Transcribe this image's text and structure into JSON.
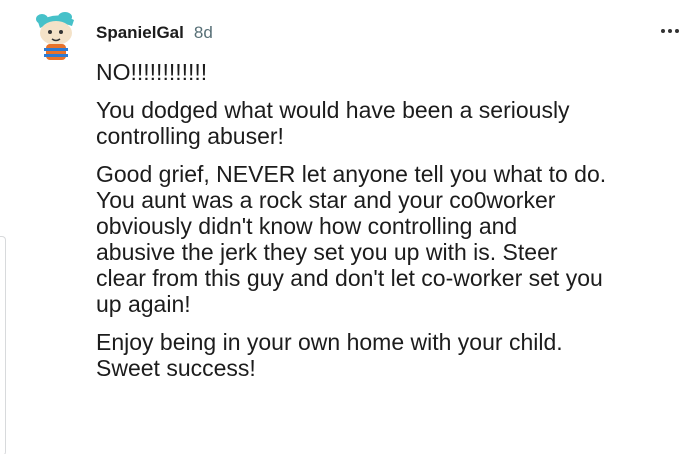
{
  "comment": {
    "username": "SpanielGal",
    "age": "8d",
    "paragraphs": [
      "NO!!!!!!!!!!!!",
      "You dodged what would have been a seriously\ncontrolling abuser!",
      "Good grief, NEVER let anyone tell you what to do.\nYou aunt was a rock star and your co0worker\nobviously didn't know how controlling and\nabusive the jerk they set you up with is. Steer\nclear from this guy and don't let co-worker set you\nup again!",
      "Enjoy being in your own home with your child.\nSweet success!"
    ]
  },
  "icons": {
    "avatar": "cartoon-avatar-icon",
    "more": "more-options-icon"
  },
  "colors": {
    "text": "#1c1c1c",
    "meta": "#576f76",
    "avatar_face": "#f4e2c8",
    "avatar_hat": "#46c1c9",
    "avatar_shirt": "#e8722a"
  }
}
